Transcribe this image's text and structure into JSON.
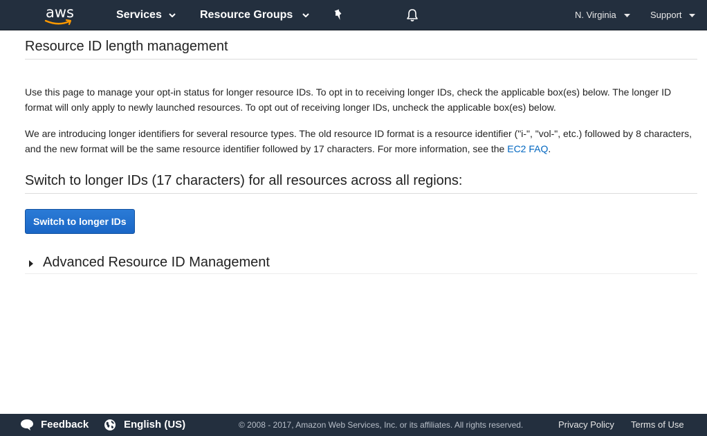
{
  "header": {
    "logo_text": "aws",
    "services_label": "Services",
    "resource_groups_label": "Resource Groups",
    "region_label": "N. Virginia",
    "support_label": "Support",
    "pin_icon": "pin-icon",
    "bell_icon": "bell-icon"
  },
  "main": {
    "title": "Resource ID length management",
    "para1": "Use this page to manage your opt-in status for longer resource IDs. To opt in to receiving longer IDs, check the applicable box(es) below. The longer ID format will only apply to newly launched resources. To opt out of receiving longer IDs, uncheck the applicable box(es) below.",
    "para2_text": "We are introducing longer identifiers for several resource types. The old resource ID format is a resource identifier (\"i-\", \"vol-\", etc.) followed by 8 characters, and the new format will be the same resource identifier followed by 17 characters. For more information, see the ",
    "para2_link": "EC2 FAQ",
    "para2_end": ".",
    "section_title": "Switch to longer IDs (17 characters) for all resources across all regions:",
    "switch_button": "Switch to longer IDs",
    "advanced_label": "Advanced Resource ID Management"
  },
  "footer": {
    "feedback_label": "Feedback",
    "language_label": "English (US)",
    "copyright": "© 2008 - 2017, Amazon Web Services, Inc. or its affiliates. All rights reserved.",
    "privacy_label": "Privacy Policy",
    "terms_label": "Terms of Use"
  },
  "colors": {
    "nav_bg": "#232f3e",
    "primary_button": "#1f6fcf",
    "link": "#0066c0",
    "logo_smile": "#ff9900"
  }
}
